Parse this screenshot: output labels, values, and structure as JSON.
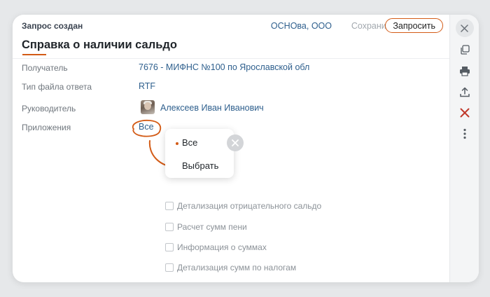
{
  "header": {
    "status": "Запрос создан",
    "organization": "ОСНОва, ООО",
    "save_label": "Сохранить",
    "request_label": "Запросить"
  },
  "title": "Справка о наличии сальдо",
  "fields": {
    "recipient": {
      "label": "Получатель",
      "value": "7676 - МИФНС №100 по Ярославской обл"
    },
    "file_type": {
      "label": "Тип файла ответа",
      "value": "RTF"
    },
    "manager": {
      "label": "Руководитель",
      "value": "Алексеев Иван Иванович"
    },
    "attachments": {
      "label": "Приложения",
      "value": "Все"
    }
  },
  "popup": {
    "options": [
      "Все",
      "Выбрать"
    ],
    "selected": "Все"
  },
  "attachments_list": [
    "Детализация отрицательного сальдо",
    "Расчет сумм пени",
    "Информация о суммах",
    "Детализация сумм по налогам"
  ],
  "sidebar_icons": [
    "close-icon",
    "copy-icon",
    "print-icon",
    "upload-icon",
    "delete-icon",
    "more-icon"
  ],
  "colors": {
    "accent": "#d35b16",
    "link": "#2e5f8d",
    "delete": "#c0392b"
  }
}
